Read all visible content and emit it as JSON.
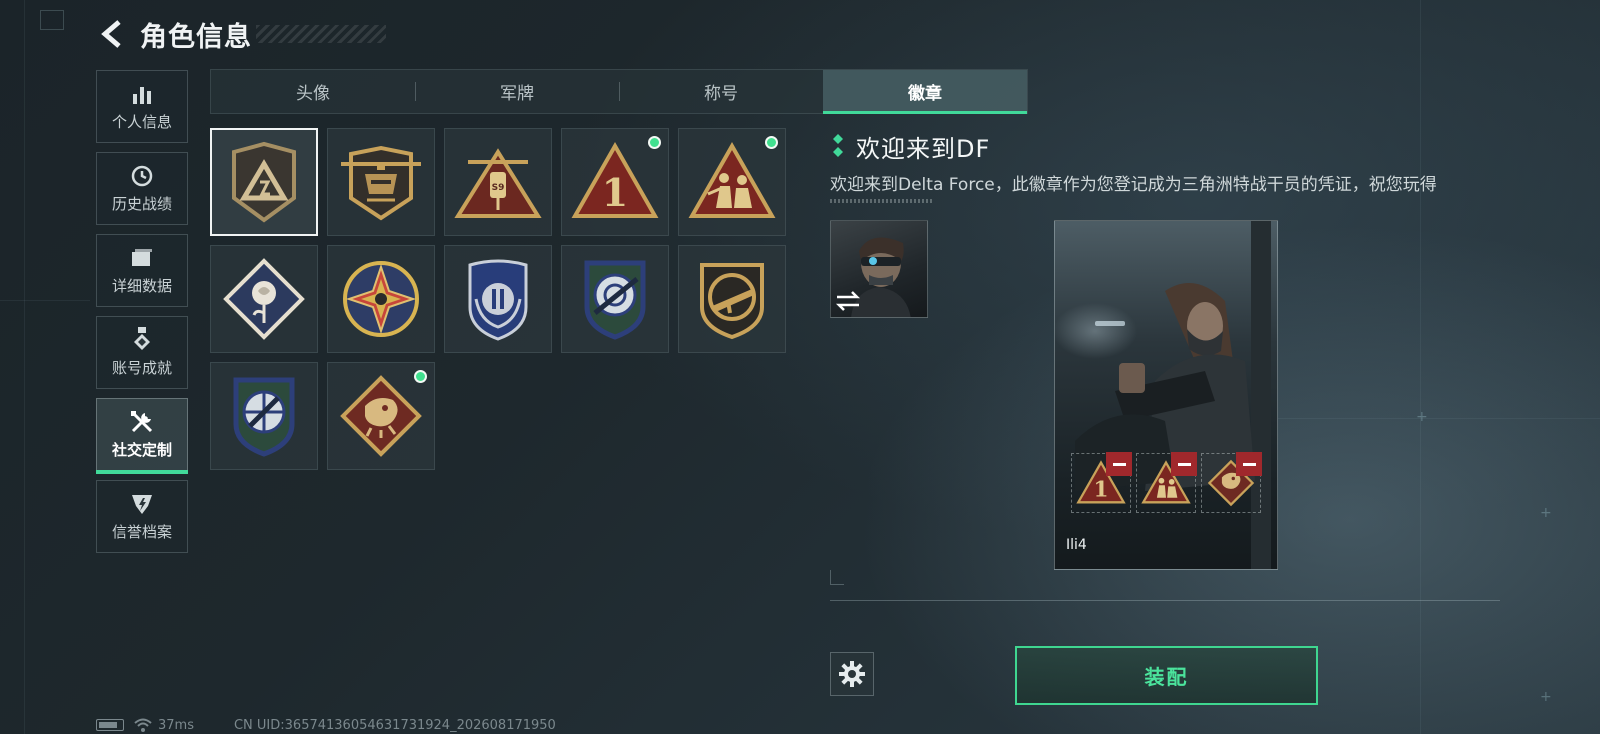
{
  "header": {
    "title": "角色信息"
  },
  "side_nav": [
    {
      "label": "个人信息",
      "icon": "bar-chart-icon",
      "active": false
    },
    {
      "label": "历史战绩",
      "icon": "history-clock-icon",
      "active": false
    },
    {
      "label": "详细数据",
      "icon": "folder-icon",
      "active": false
    },
    {
      "label": "账号成就",
      "icon": "medal-icon",
      "active": false
    },
    {
      "label": "社交定制",
      "icon": "tools-icon",
      "active": true
    },
    {
      "label": "信誉档案",
      "icon": "credit-shield-icon",
      "active": false
    }
  ],
  "tabs": [
    {
      "label": "头像",
      "active": false
    },
    {
      "label": "军牌",
      "active": false
    },
    {
      "label": "称号",
      "active": false
    },
    {
      "label": "徽章",
      "active": true
    }
  ],
  "badges": [
    {
      "icon": "delta-shield-badge-icon",
      "selected": true,
      "new": false
    },
    {
      "icon": "helicopter-badge-icon",
      "selected": false,
      "new": false
    },
    {
      "icon": "s9-rocket-badge-icon",
      "selected": false,
      "new": false
    },
    {
      "icon": "number-one-triangle-badge-icon",
      "selected": false,
      "new": true
    },
    {
      "icon": "soldiers-triangle-badge-icon",
      "selected": false,
      "new": true
    },
    {
      "icon": "rose-diamond-badge-icon",
      "selected": false,
      "new": false
    },
    {
      "icon": "star-compass-badge-icon",
      "selected": false,
      "new": false
    },
    {
      "icon": "blue-laurel-shield-badge-icon",
      "selected": false,
      "new": false
    },
    {
      "icon": "rifle-crosshair-badge-icon",
      "selected": false,
      "new": false
    },
    {
      "icon": "gold-rifle-badge-icon",
      "selected": false,
      "new": false
    },
    {
      "icon": "knife-crosshair-badge-icon",
      "selected": false,
      "new": false
    },
    {
      "icon": "dragon-diamond-badge-icon",
      "selected": false,
      "new": true
    }
  ],
  "detail": {
    "title": "欢迎来到DF",
    "description": "欢迎来到Delta Force，此徽章作为您登记成为三角洲特战干员的凭证，祝您玩得"
  },
  "card": {
    "player_name": "Ili4",
    "equipped_slots": [
      "number-one-triangle-badge-icon",
      "soldiers-triangle-badge-icon",
      "dragon-diamond-badge-icon"
    ]
  },
  "actions": {
    "equip_label": "装配"
  },
  "status": {
    "ping": "37ms",
    "uid": "CN UID:36574136054631731924_202608171950"
  },
  "colors": {
    "accent": "#41d99a",
    "remove": "#a0282c",
    "gold": "#c8a25a"
  }
}
